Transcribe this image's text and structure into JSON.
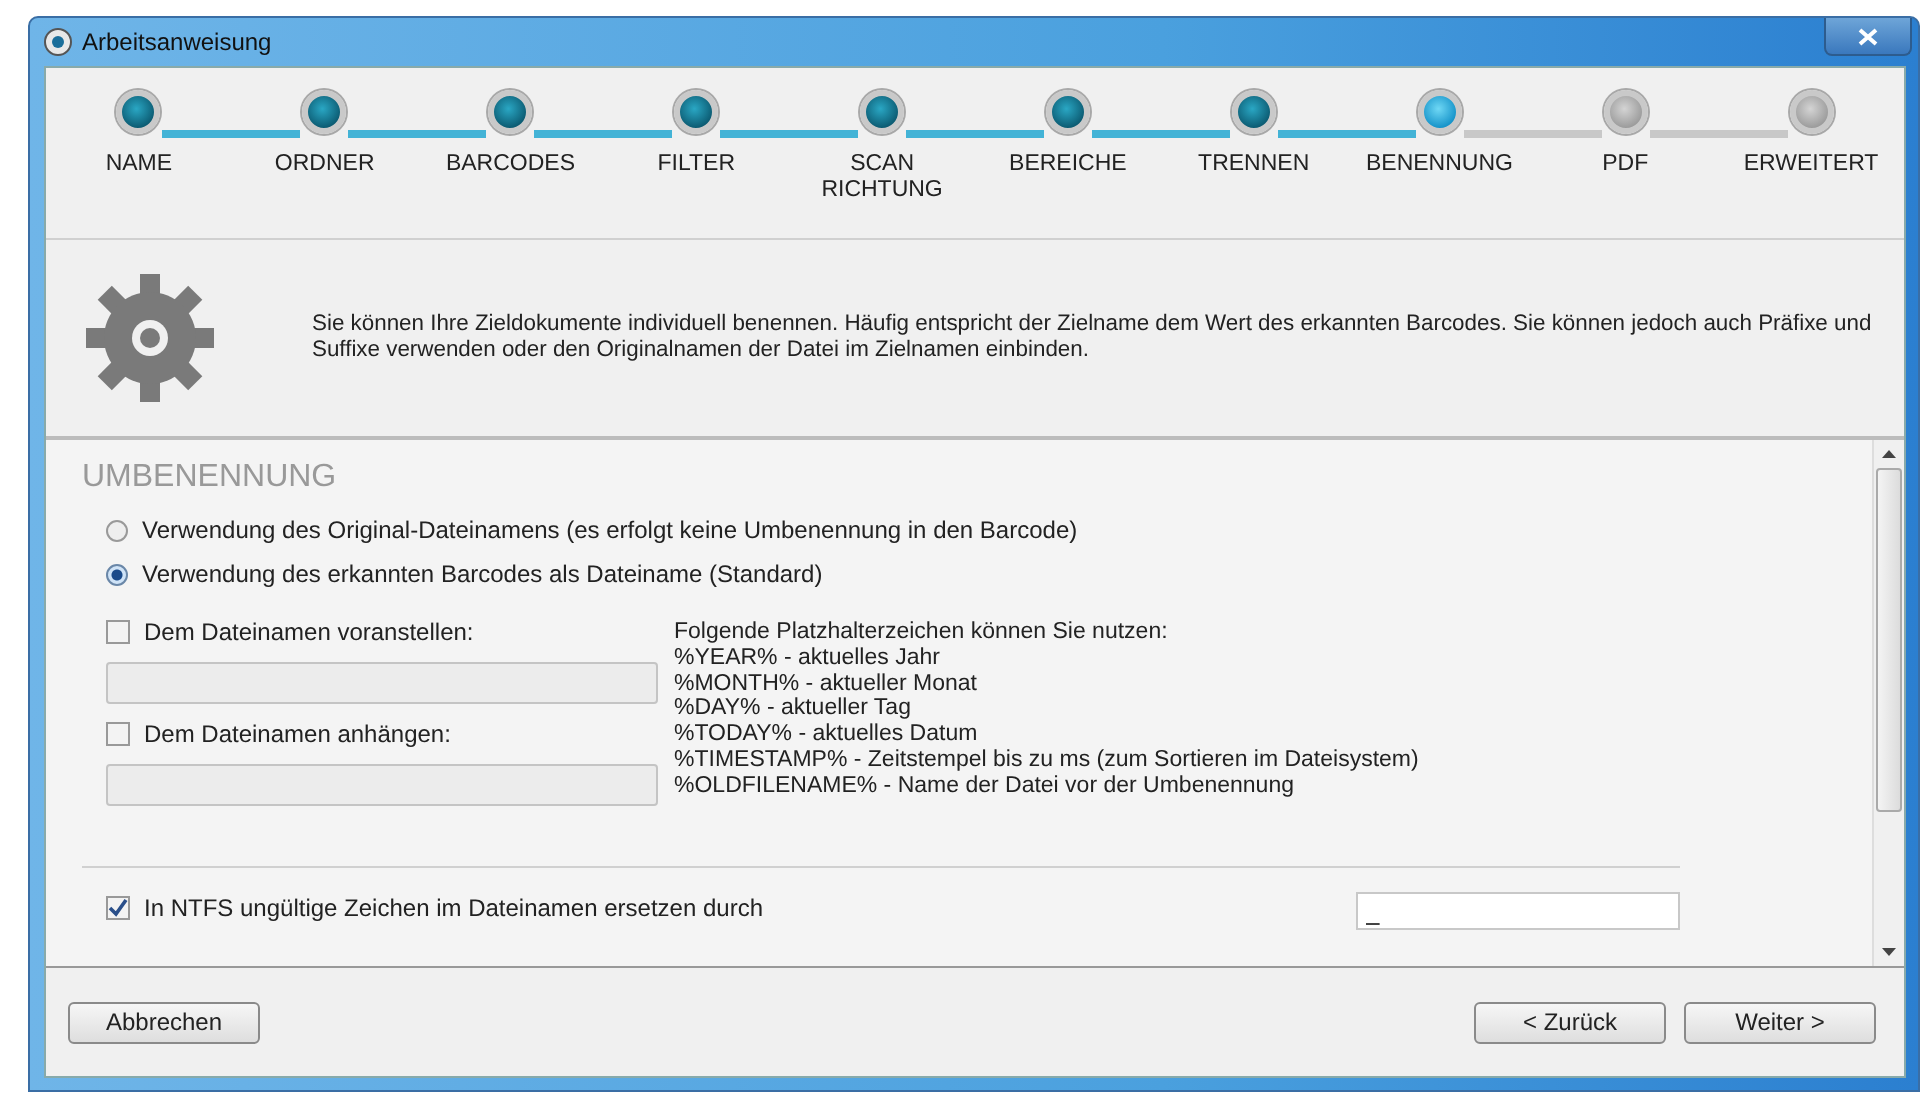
{
  "window": {
    "title": "Arbeitsanweisung"
  },
  "steps": [
    {
      "label": "NAME",
      "kind": "done"
    },
    {
      "label": "ORDNER",
      "kind": "done"
    },
    {
      "label": "BARCODES",
      "kind": "done"
    },
    {
      "label": "FILTER",
      "kind": "done"
    },
    {
      "label": "SCAN RICHTUNG",
      "kind": "done"
    },
    {
      "label": "BEREICHE",
      "kind": "done"
    },
    {
      "label": "TRENNEN",
      "kind": "done"
    },
    {
      "label": "BENENNUNG",
      "kind": "current"
    },
    {
      "label": "PDF",
      "kind": "pending"
    },
    {
      "label": "ERWEITERT",
      "kind": "pending"
    }
  ],
  "description": "Sie können Ihre Zieldokumente individuell benennen. Häufig entspricht der Zielname dem Wert des erkannten Barcodes. Sie können jedoch auch Präfixe und Suffixe verwenden oder den Originalnamen der Datei im Zielnamen einbinden.",
  "section": {
    "title": "UMBENENNUNG"
  },
  "rename_options": [
    {
      "label": "Verwendung des Original-Dateinamens (es erfolgt keine Umbenennung in den Barcode)",
      "selected": false
    },
    {
      "label": "Verwendung des erkannten Barcodes als Dateiname (Standard)",
      "selected": true
    }
  ],
  "affixes": [
    {
      "label": "Dem Dateinamen voranstellen:",
      "checked": false
    },
    {
      "label": "Dem Dateinamen anhängen:",
      "checked": false
    }
  ],
  "placeholder_help": {
    "intro": "Folgende Platzhalterzeichen können Sie nutzen:",
    "lines": [
      "%YEAR% - aktuelles Jahr",
      "%MONTH% - aktueller Monat",
      "%DAY% - aktueller Tag",
      "%TODAY% - aktuelles Datum",
      "%TIMESTAMP% - Zeitstempel bis zu ms (zum Sortieren im Dateisystem)",
      "%OLDFILENAME% - Name der Datei vor der Umbenennung"
    ]
  },
  "ntfs": {
    "label": "In NTFS ungültige Zeichen im Dateinamen ersetzen durch",
    "checked": true,
    "value": "_"
  },
  "buttons": {
    "cancel": "Abbrechen",
    "back": "< Zurück",
    "next": "Weiter >"
  }
}
